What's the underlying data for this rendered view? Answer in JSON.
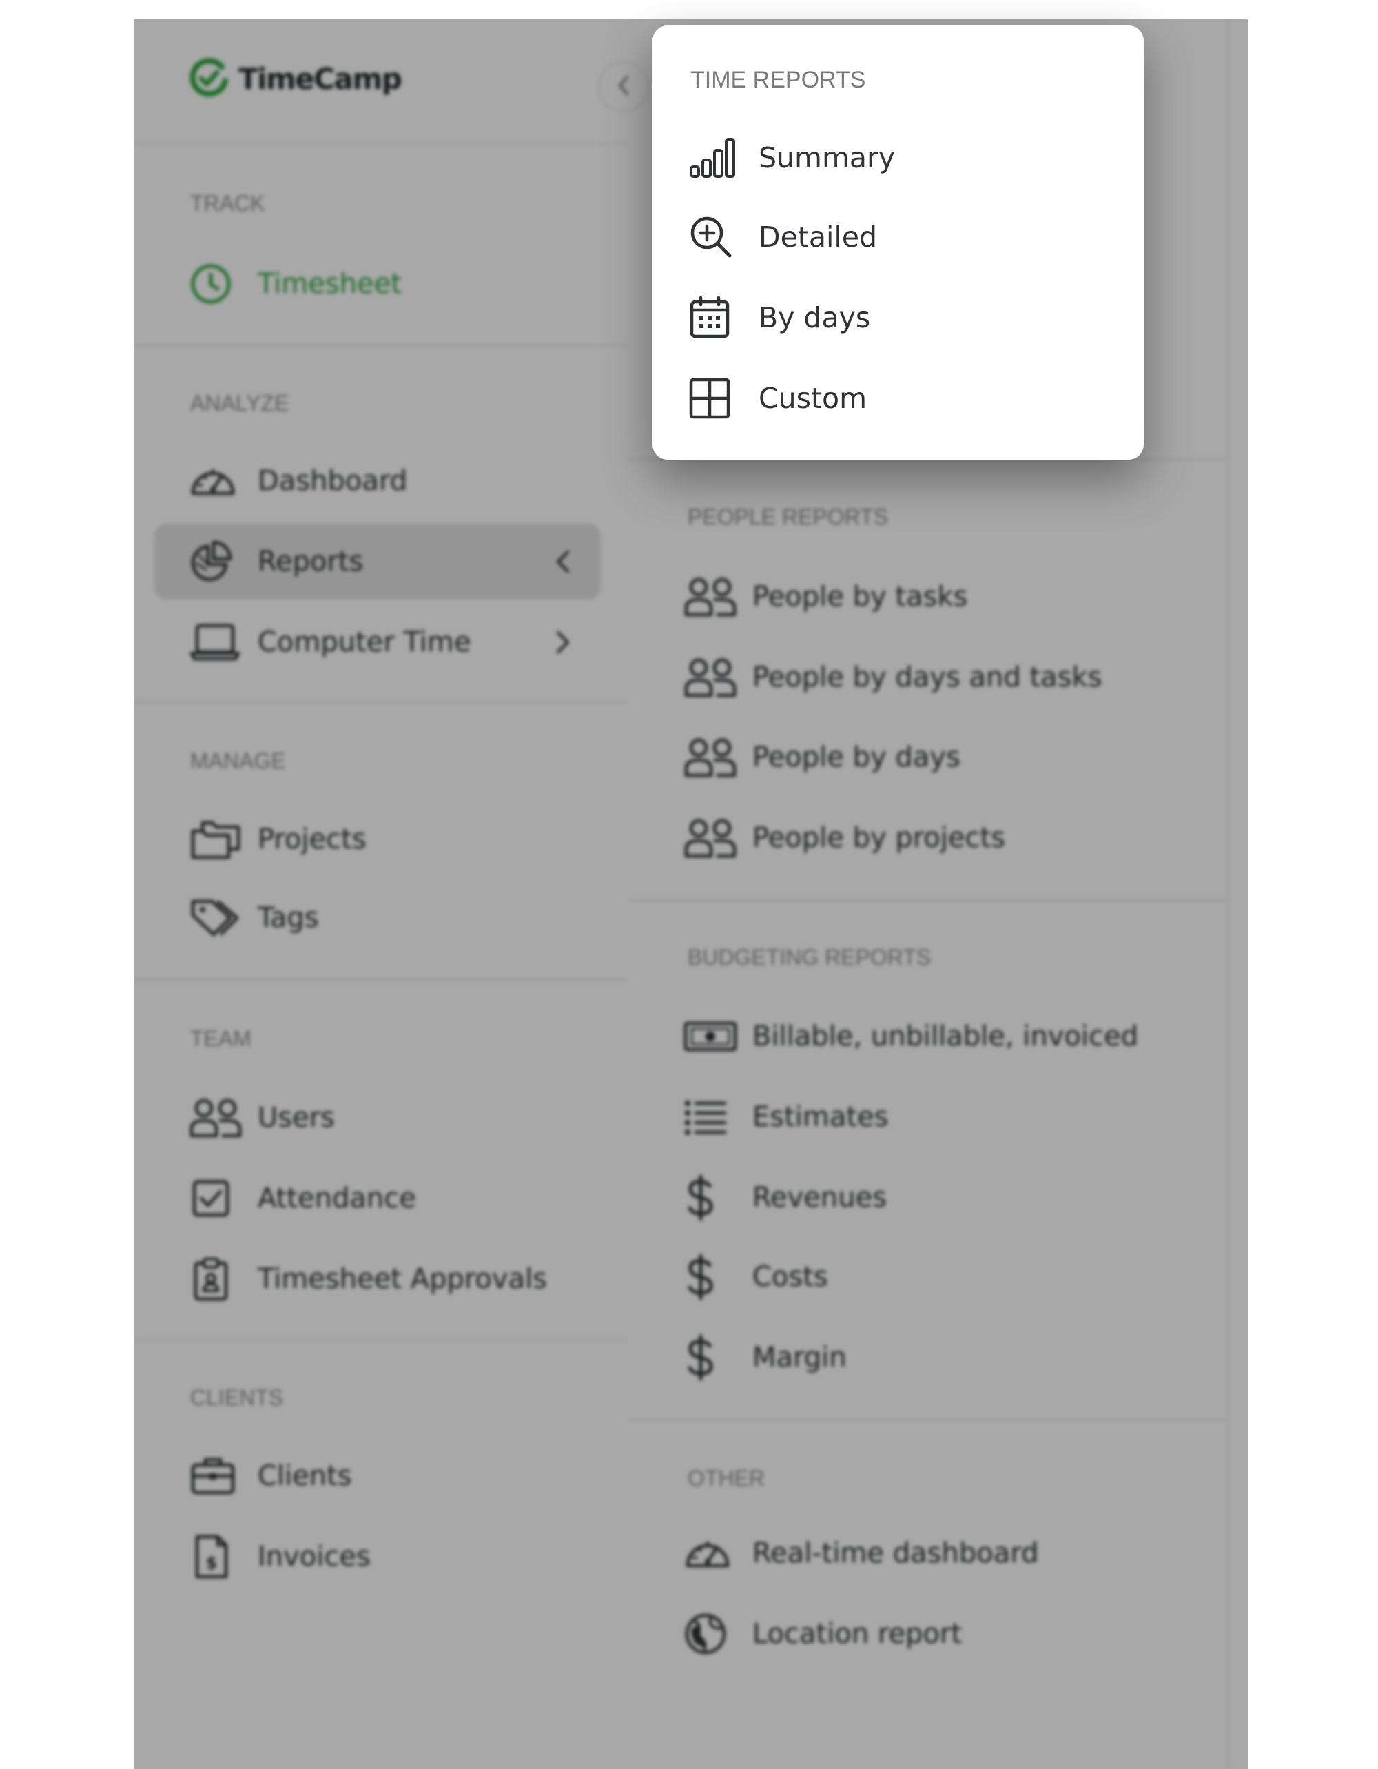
{
  "app": {
    "name": "TimeCamp"
  },
  "colors": {
    "brand_green": "#2ea63c",
    "text_dark": "#2b3133",
    "section_gray": "#8e8e8e"
  },
  "sidebar": {
    "sections": [
      {
        "label": "TRACK",
        "items": [
          {
            "label": "Timesheet",
            "icon": "clock-icon",
            "active_route": true
          }
        ]
      },
      {
        "label": "ANALYZE",
        "items": [
          {
            "label": "Dashboard",
            "icon": "speedometer-icon"
          },
          {
            "label": "Reports",
            "icon": "pie-chart-icon",
            "expanded": true,
            "chevron": "chevron-left"
          },
          {
            "label": "Computer Time",
            "icon": "laptop-icon",
            "chevron": "chevron-right"
          }
        ]
      },
      {
        "label": "MANAGE",
        "items": [
          {
            "label": "Projects",
            "icon": "folders-icon"
          },
          {
            "label": "Tags",
            "icon": "tags-icon"
          }
        ]
      },
      {
        "label": "TEAM",
        "items": [
          {
            "label": "Users",
            "icon": "users-icon"
          },
          {
            "label": "Attendance",
            "icon": "checkbox-icon"
          },
          {
            "label": "Timesheet Approvals",
            "icon": "clipboard-icon"
          }
        ]
      },
      {
        "label": "CLIENTS",
        "items": [
          {
            "label": "Clients",
            "icon": "briefcase-icon"
          },
          {
            "label": "Invoices",
            "icon": "invoice-icon"
          }
        ]
      }
    ]
  },
  "reports_menu": {
    "sections": [
      {
        "label": "PEOPLE REPORTS",
        "items": [
          {
            "label": "People by tasks",
            "icon": "users-icon"
          },
          {
            "label": "People by days and tasks",
            "icon": "users-icon"
          },
          {
            "label": "People by days",
            "icon": "users-icon"
          },
          {
            "label": "People by projects",
            "icon": "users-icon"
          }
        ]
      },
      {
        "label": "BUDGETING REPORTS",
        "items": [
          {
            "label": "Billable, unbillable, invoiced",
            "icon": "banknote-icon"
          },
          {
            "label": "Estimates",
            "icon": "list-icon"
          },
          {
            "label": "Revenues",
            "icon": "dollar-icon"
          },
          {
            "label": "Costs",
            "icon": "dollar-icon"
          },
          {
            "label": "Margin",
            "icon": "dollar-icon"
          }
        ]
      },
      {
        "label": "OTHER",
        "items": [
          {
            "label": "Real-time dashboard",
            "icon": "speedometer-icon"
          },
          {
            "label": "Location report",
            "icon": "globe-icon"
          }
        ]
      }
    ]
  },
  "popup": {
    "label": "TIME REPORTS",
    "items": [
      {
        "label": "Summary",
        "icon": "signal-bars-icon"
      },
      {
        "label": "Detailed",
        "icon": "zoom-in-icon"
      },
      {
        "label": "By days",
        "icon": "calendar-icon"
      },
      {
        "label": "Custom",
        "icon": "grid-icon"
      }
    ]
  }
}
